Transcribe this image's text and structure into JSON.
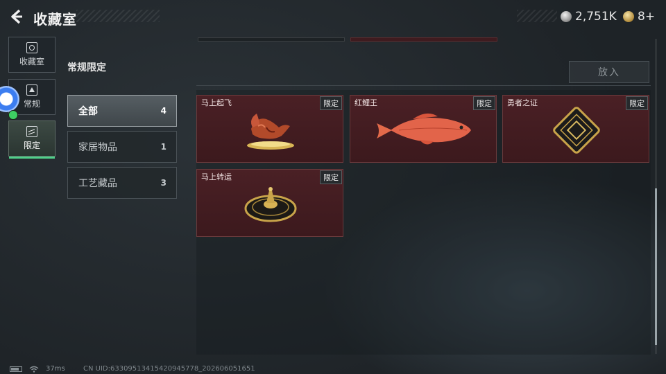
{
  "header": {
    "title": "收藏室",
    "currency_silver": "2,751K",
    "currency_gold": "8+"
  },
  "sidebar": {
    "tabs": [
      {
        "label": "收藏室",
        "icon": "collection-room-icon",
        "active": false
      },
      {
        "label": "常规",
        "icon": "regular-icon",
        "active": false
      },
      {
        "label": "限定",
        "icon": "limited-icon",
        "active": true
      }
    ]
  },
  "main": {
    "section_title": "常规限定",
    "put_button": "放入",
    "categories": [
      {
        "label": "全部",
        "count": "4",
        "active": true
      },
      {
        "label": "家居物品",
        "count": "1",
        "active": false
      },
      {
        "label": "工艺藏品",
        "count": "3",
        "active": false
      }
    ],
    "items": [
      {
        "name": "马上起飞",
        "badge": "限定",
        "icon": "horse-statue-icon"
      },
      {
        "name": "红鲤王",
        "badge": "限定",
        "icon": "red-carp-icon"
      },
      {
        "name": "勇者之证",
        "badge": "限定",
        "icon": "brave-card-icon"
      },
      {
        "name": "马上转运",
        "badge": "限定",
        "icon": "fortune-wheel-icon"
      }
    ]
  },
  "status": {
    "ping": "37ms",
    "uid": "CN UID:63309513415420945778_202606051651"
  },
  "colors": {
    "card_background": "#3f1b1f",
    "active_tab_accent": "#4fd08a",
    "gold": "#c9a44a"
  }
}
